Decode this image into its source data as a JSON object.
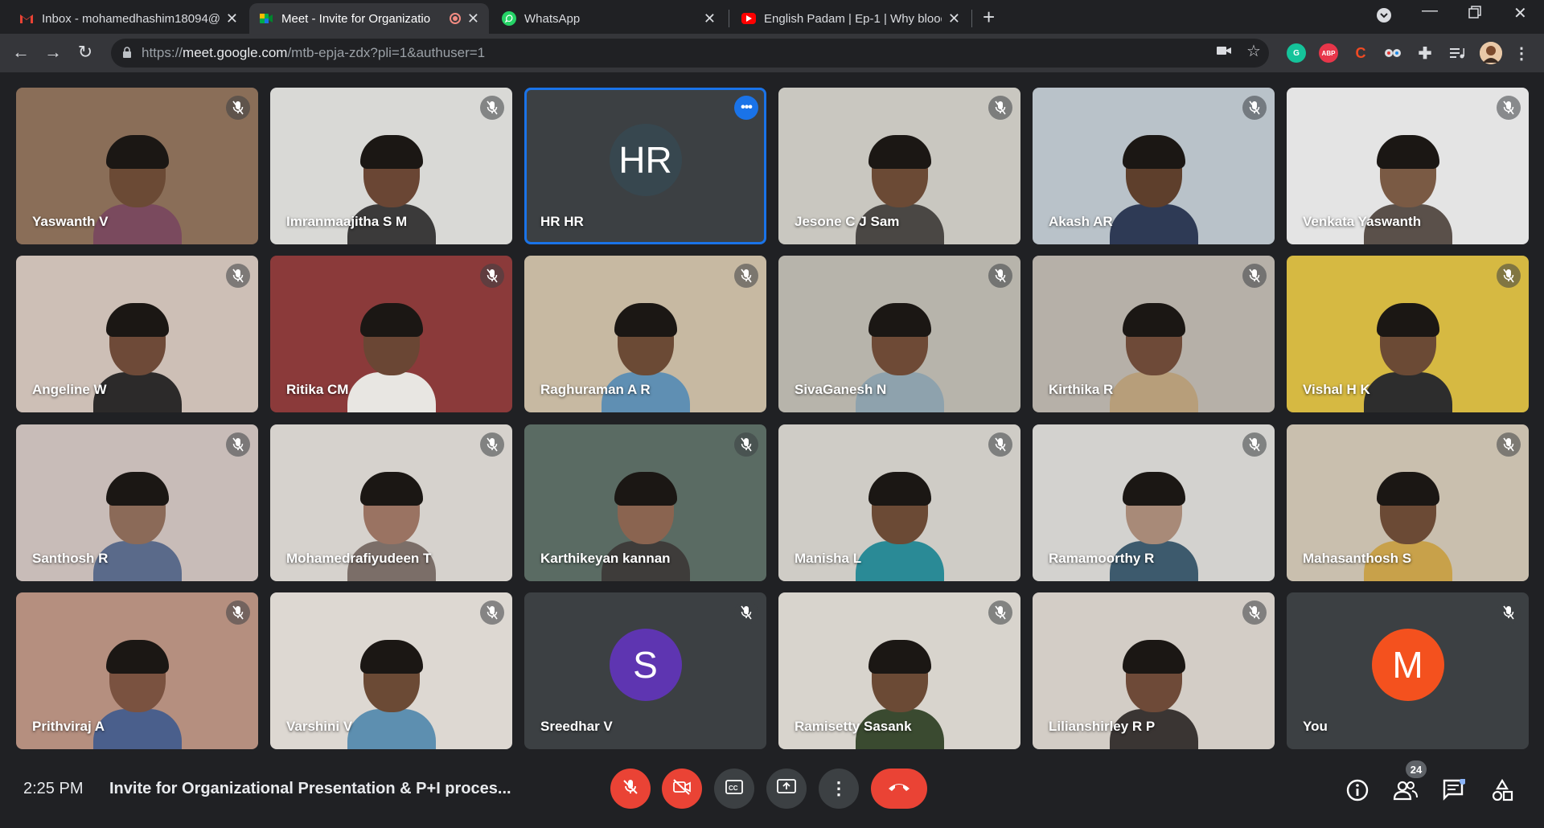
{
  "tabs": [
    {
      "title": "Inbox - mohamedhashim18094@",
      "favicon": "gmail-icon",
      "active": false
    },
    {
      "title": "Meet - Invite for Organizatio",
      "favicon": "meet-icon",
      "active": true
    },
    {
      "title": "WhatsApp",
      "favicon": "whatsapp-icon",
      "active": false
    },
    {
      "title": "English Padam | Ep-1 | Why blood",
      "favicon": "youtube-icon",
      "active": false
    }
  ],
  "omnibox": {
    "url_prefix": "https://",
    "url_host": "meet.google.com",
    "url_path": "/mtb-epja-zdx?pli=1&authuser=1"
  },
  "extensions": [
    {
      "label": "G",
      "color": "#15c39a"
    },
    {
      "label": "ABP",
      "color": "#e8364a"
    },
    {
      "label": "C",
      "color": "#f04a23"
    }
  ],
  "participants": [
    {
      "name": "Yaswanth V",
      "bg": "#8a6e58",
      "skin": "#6b4a35",
      "shirt": "#7a4a5e",
      "muted": true
    },
    {
      "name": "Imranmaajitha S M",
      "bg": "#d9d9d6",
      "skin": "#6a4634",
      "shirt": "#3b3a3a",
      "muted": true
    },
    {
      "name": "HR HR",
      "avatar": "HR",
      "avatar_color": "#37474f",
      "muted": false,
      "active": true
    },
    {
      "name": "Jesone C J Sam",
      "bg": "#c9c7c0",
      "skin": "#6b4a35",
      "shirt": "#4a4744",
      "muted": true
    },
    {
      "name": "Akash AR",
      "bg": "#b9c2c9",
      "skin": "#5e3f2c",
      "shirt": "#2e3a55",
      "muted": true
    },
    {
      "name": "Venkata Yaswanth",
      "bg": "#e4e4e4",
      "skin": "#7a5a44",
      "shirt": "#5a504a",
      "muted": true
    },
    {
      "name": "Angeline W",
      "bg": "#cdbfb6",
      "skin": "#6e4a38",
      "shirt": "#2c2a2a",
      "muted": true
    },
    {
      "name": "Ritika CM",
      "bg": "#8b3a3a",
      "skin": "#6a4634",
      "shirt": "#e8e6e2",
      "muted": true
    },
    {
      "name": "Raghuraman A R",
      "bg": "#c7b9a2",
      "skin": "#6b4a35",
      "shirt": "#5f8fb3",
      "muted": true
    },
    {
      "name": "SivaGanesh N",
      "bg": "#b7b4ab",
      "skin": "#6e4a36",
      "shirt": "#8ea2ad",
      "muted": true
    },
    {
      "name": "Kirthika R",
      "bg": "#b6b0a8",
      "skin": "#6e4a38",
      "shirt": "#b79e7a",
      "muted": true
    },
    {
      "name": "Vishal H K",
      "bg": "#d6b942",
      "skin": "#6b4a35",
      "shirt": "#2d2d2d",
      "muted": true
    },
    {
      "name": "Santhosh R",
      "bg": "#c8bcb8",
      "skin": "#8b6a58",
      "shirt": "#5a6a8a",
      "muted": true
    },
    {
      "name": "Mohamedrafiyudeen T",
      "bg": "#d6d2cd",
      "skin": "#9a7362",
      "shirt": "#7b6e68",
      "muted": true
    },
    {
      "name": "Karthikeyan kannan",
      "bg": "#5a6b63",
      "skin": "#8a6450",
      "shirt": "#3e3c3a",
      "muted": true
    },
    {
      "name": "Manisha L",
      "bg": "#cfccc6",
      "skin": "#6b4a35",
      "shirt": "#2a8a96",
      "muted": true
    },
    {
      "name": "Ramamoorthy R",
      "bg": "#d3d2cf",
      "skin": "#a88a78",
      "shirt": "#3d5a6d",
      "muted": true
    },
    {
      "name": "Mahasanthosh S",
      "bg": "#c9bfae",
      "skin": "#6b4a35",
      "shirt": "#c8a14a",
      "muted": true
    },
    {
      "name": "Prithviraj A",
      "bg": "#b58f7f",
      "skin": "#7a5240",
      "shirt": "#4a5f8c",
      "muted": true
    },
    {
      "name": "Varshini V",
      "bg": "#ddd8d2",
      "skin": "#6b4a35",
      "shirt": "#5d8fb0",
      "muted": true
    },
    {
      "name": "Sreedhar V",
      "avatar": "S",
      "avatar_color": "#5e35b1",
      "muted": true
    },
    {
      "name": "Ramisetty Sasank",
      "bg": "#d8d4cd",
      "skin": "#6b4a35",
      "shirt": "#3a4a30",
      "muted": true
    },
    {
      "name": "Lilianshirley R P",
      "bg": "#d3cdc6",
      "skin": "#6e4a38",
      "shirt": "#3a3533",
      "muted": true
    },
    {
      "name": "You",
      "avatar": "M",
      "avatar_color": "#f4511e",
      "muted": true
    }
  ],
  "bottom": {
    "time": "2:25 PM",
    "title": "Invite for Organizational Presentation & P+I proces...",
    "participant_count": "24"
  }
}
